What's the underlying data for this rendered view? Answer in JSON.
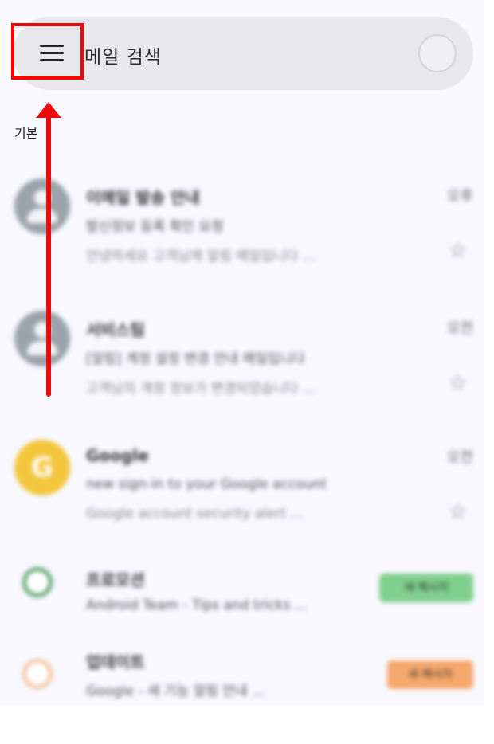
{
  "search": {
    "placeholder": "메일 검색"
  },
  "section": {
    "label": "기본"
  },
  "emails": [
    {
      "sender": "이메일 발송 안내",
      "subject": "발신정보 등록 확인 요청",
      "snippet": "안녕하세요 고객님께 알림 메일입니다 ...",
      "time": "오후"
    },
    {
      "sender": "서비스팀",
      "subject": "[알림] 계정 설정 변경 안내 메일입니다",
      "snippet": "고객님의 계정 정보가 변경되었습니다 ...",
      "time": "오전"
    },
    {
      "sender": "Google",
      "subject": "new sign-in to your Google account",
      "snippet": "Google account security alert ...",
      "time": "오전"
    },
    {
      "sender": "프로모션",
      "subject": "Android Team - Tips and tricks ...",
      "tag": "새 메시지"
    },
    {
      "sender": "업데이트",
      "subject": "Google - 새 기능 알림 안내 ...",
      "tag": "새 메시지"
    }
  ],
  "colors": {
    "highlight": "#ff0000",
    "arrow": "#ee0b0b",
    "google_avatar": "#f3c53c",
    "tag_green": "#7fcf8d",
    "tag_orange": "#f6a76b"
  },
  "icons": [
    "menu-icon",
    "account-icon",
    "star-icon",
    "arrow-up-icon"
  ]
}
